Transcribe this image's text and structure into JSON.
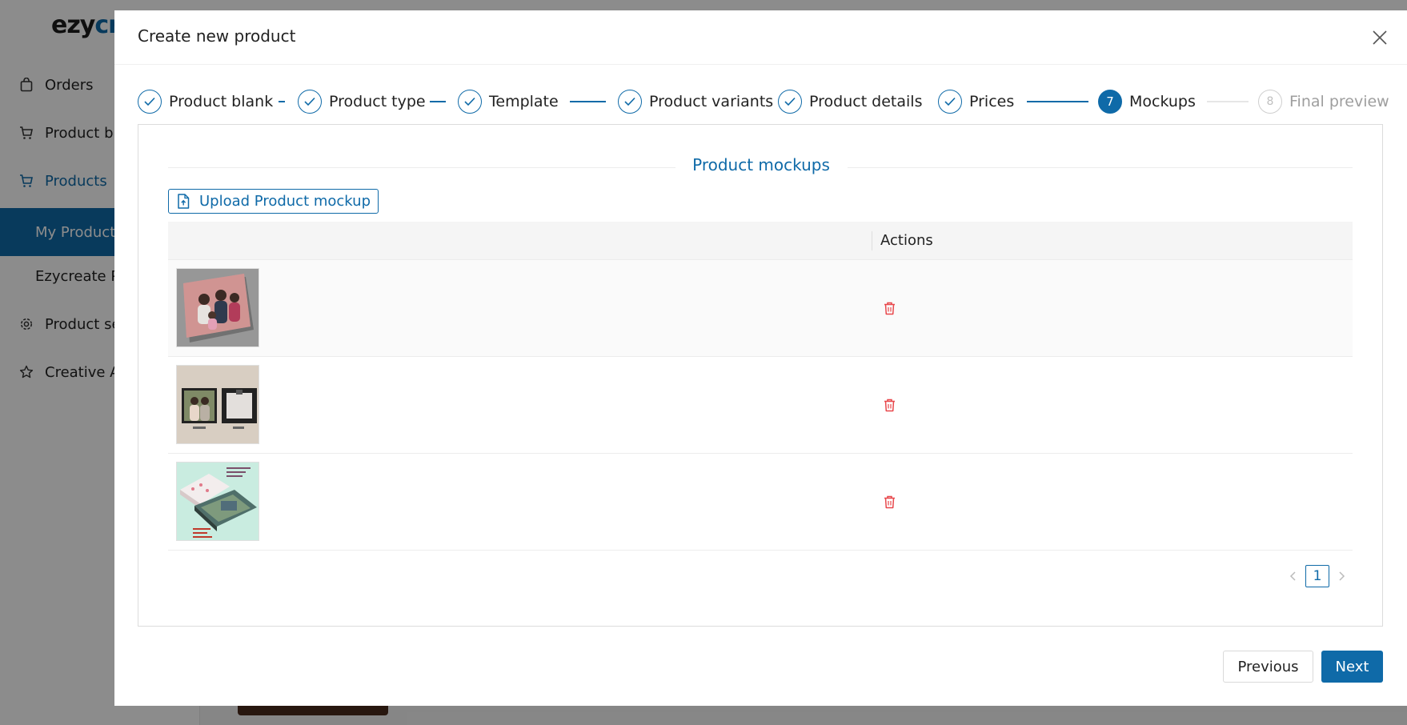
{
  "app": {
    "logo_part1": "ezy",
    "logo_part2": "cre",
    "sidebar": [
      {
        "label": "Orders",
        "icon": "bag-icon"
      },
      {
        "label": "Product bla",
        "icon": "cart-icon"
      },
      {
        "label": "Products",
        "icon": "cart-icon"
      },
      {
        "label": "My Product",
        "icon": ""
      },
      {
        "label": "Ezycreate P",
        "icon": ""
      },
      {
        "label": "Product se",
        "icon": "gear-icon"
      },
      {
        "label": "Creative A",
        "icon": "star-icon"
      }
    ]
  },
  "modal": {
    "title": "Create new product",
    "steps": [
      {
        "label": "Product blank",
        "state": "done"
      },
      {
        "label": "Product type",
        "state": "done"
      },
      {
        "label": "Template",
        "state": "done"
      },
      {
        "label": "Product variants",
        "state": "done"
      },
      {
        "label": "Product details",
        "state": "done"
      },
      {
        "label": "Prices",
        "state": "done"
      },
      {
        "label": "Mockups",
        "state": "current",
        "number": "7"
      },
      {
        "label": "Final preview",
        "state": "pending",
        "number": "8"
      }
    ],
    "section_title": "Product mockups",
    "upload_label": "Upload Product mockup",
    "table": {
      "actions_header": "Actions",
      "rows": [
        {
          "thumbnail": "family-canvas-mockup"
        },
        {
          "thumbnail": "couple-front-back-mockup"
        },
        {
          "thumbnail": "premium-canvas-feature-mockup"
        }
      ]
    },
    "pagination": {
      "current_page": "1"
    },
    "footer": {
      "previous_label": "Previous",
      "next_label": "Next"
    }
  },
  "colors": {
    "primary": "#0f6aa8",
    "danger": "#e8474b",
    "overlay": "rgba(0,0,0,0.45)"
  }
}
